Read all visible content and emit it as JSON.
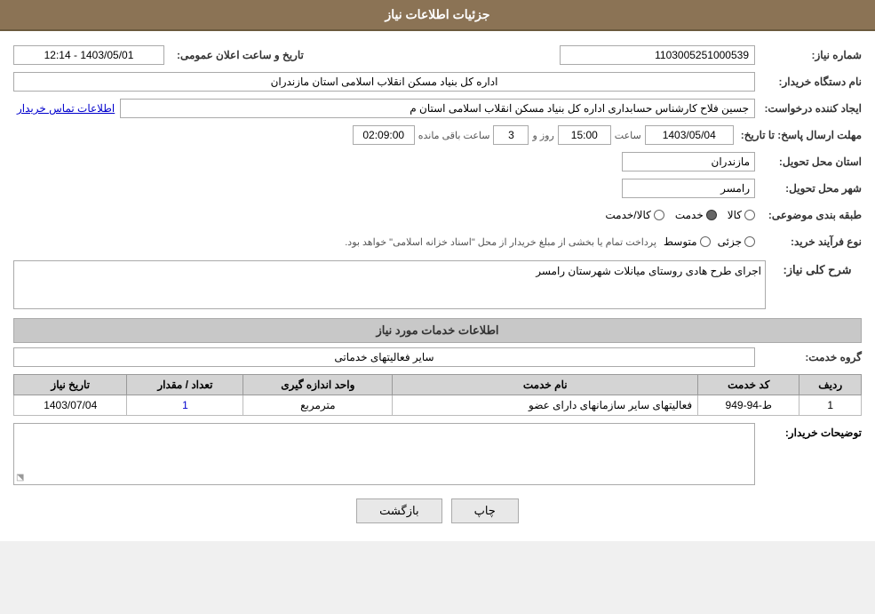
{
  "header": {
    "title": "جزئیات اطلاعات نیاز"
  },
  "fields": {
    "need_number_label": "شماره نیاز:",
    "need_number_value": "1103005251000539",
    "announce_date_label": "تاریخ و ساعت اعلان عمومی:",
    "announce_date_value": "1403/05/01 - 12:14",
    "org_name_label": "نام دستگاه خریدار:",
    "org_name_value": "اداره کل بنیاد مسکن انقلاب اسلامی استان مازندران",
    "creator_label": "ایجاد کننده درخواست:",
    "creator_value": "جسین فلاح کارشناس حسابداری اداره کل بنیاد مسکن انقلاب اسلامی استان م",
    "creator_link": "اطلاعات تماس خریدار",
    "deadline_label": "مهلت ارسال پاسخ: تا تاریخ:",
    "deadline_date": "1403/05/04",
    "deadline_time_label": "ساعت",
    "deadline_time": "15:00",
    "deadline_days_label": "روز و",
    "deadline_days": "3",
    "deadline_hours_label": "ساعت باقی مانده",
    "deadline_hours": "02:09:00",
    "province_label": "استان محل تحویل:",
    "province_value": "مازندران",
    "city_label": "شهر محل تحویل:",
    "city_value": "رامسر",
    "category_label": "طبقه بندی موضوعی:",
    "category_options": [
      "کالا",
      "خدمت",
      "کالا/خدمت"
    ],
    "category_selected": "خدمت",
    "process_label": "نوع فرآیند خرید:",
    "process_options": [
      "جزئی",
      "متوسط"
    ],
    "process_note": "پرداخت تمام یا بخشی از مبلغ خریدار از محل \"اسناد خزانه اسلامی\" خواهد بود.",
    "description_label": "شرح کلی نیاز:",
    "description_value": "اجرای طرح هادی روستای میانلات شهرستان رامسر",
    "services_section_title": "اطلاعات خدمات مورد نیاز",
    "service_group_label": "گروه خدمت:",
    "service_group_value": "سایر فعالیتهای خدماتی"
  },
  "table": {
    "columns": [
      "ردیف",
      "کد خدمت",
      "نام خدمت",
      "واحد اندازه گیری",
      "تعداد / مقدار",
      "تاریخ نیاز"
    ],
    "rows": [
      {
        "row_num": "1",
        "service_code": "ط-94-949",
        "service_name": "فعالیتهای سایر سازمانهای دارای عضو",
        "unit": "مترمربع",
        "count": "1",
        "date": "1403/07/04"
      }
    ]
  },
  "buyer_desc_label": "توضیحات خریدار:",
  "buyer_desc_value": "",
  "buttons": {
    "print_label": "چاپ",
    "back_label": "بازگشت"
  }
}
